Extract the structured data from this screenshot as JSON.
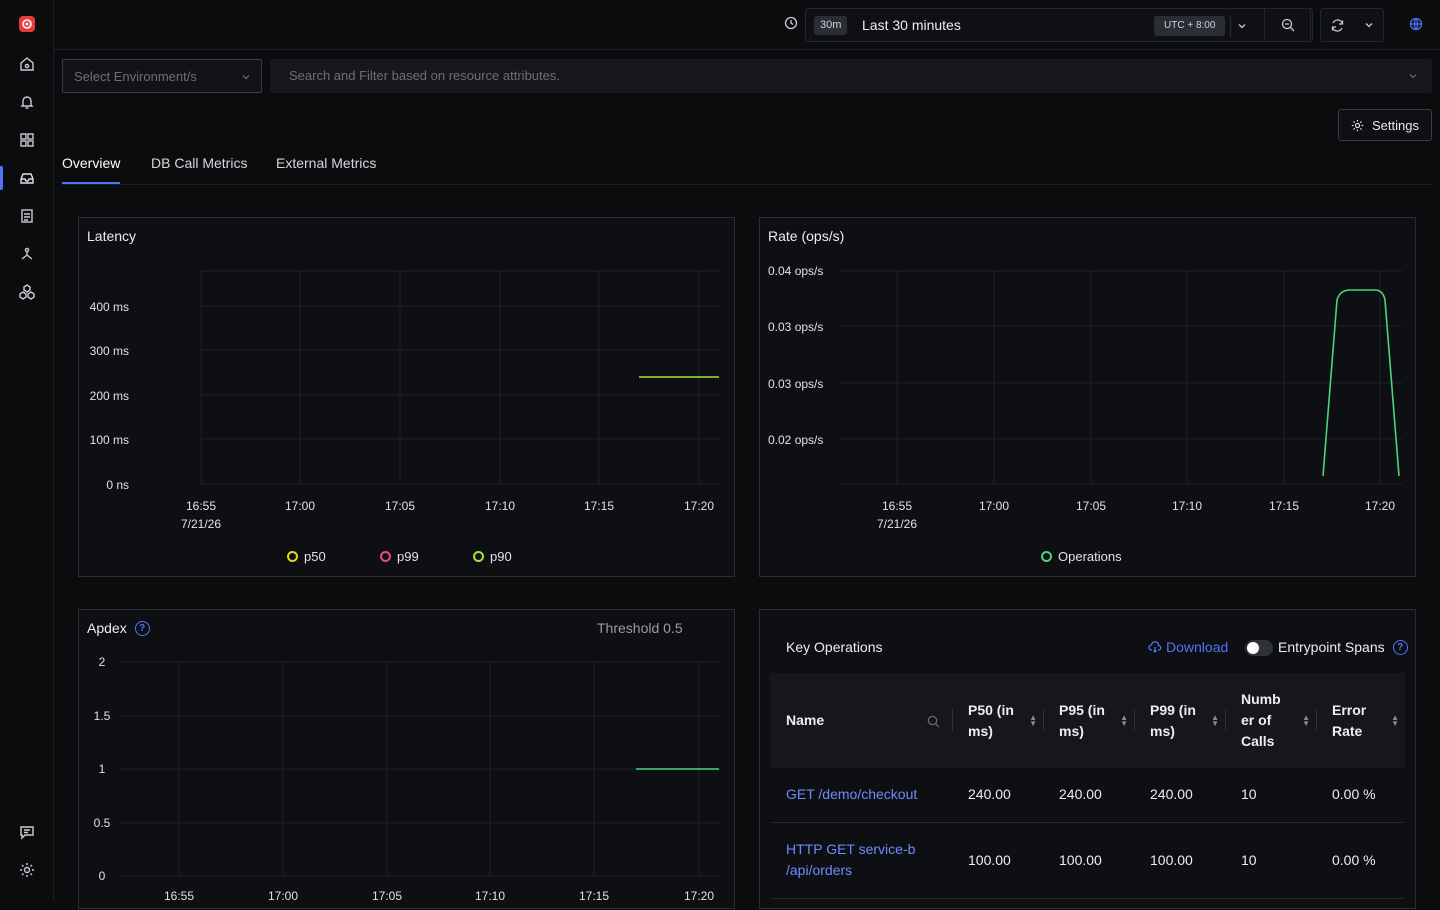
{
  "time_picker": {
    "short": "30m",
    "label": "Last 30 minutes",
    "timezone": "UTC + 8:00"
  },
  "filters": {
    "env_placeholder": "Select Environment/s",
    "search_placeholder": "Search and Filter based on resource attributes."
  },
  "settings_label": "Settings",
  "tabs": [
    {
      "label": "Overview"
    },
    {
      "label": "DB Call Metrics"
    },
    {
      "label": "External Metrics"
    }
  ],
  "latency": {
    "title": "Latency",
    "legend": [
      {
        "name": "p50",
        "color": "#e8d41a"
      },
      {
        "name": "p99",
        "color": "#e8497a"
      },
      {
        "name": "p90",
        "color": "#a6e23a"
      }
    ]
  },
  "rate": {
    "title": "Rate (ops/s)",
    "legend": [
      {
        "name": "Operations",
        "color": "#4cd37a"
      }
    ]
  },
  "apdex": {
    "title": "Apdex",
    "threshold": "Threshold 0.5"
  },
  "key_operations": {
    "title": "Key Operations",
    "download": "Download",
    "entrypoint": "Entrypoint Spans",
    "columns": [
      "Name",
      "P50 (in ms)",
      "P95 (in ms)",
      "P99 (in ms)",
      "Number of Calls",
      "Error Rate"
    ],
    "rows": [
      {
        "name": "GET /demo/checkout",
        "p50": "240.00",
        "p95": "240.00",
        "p99": "240.00",
        "calls": "10",
        "error": "0.00 %"
      },
      {
        "name": "HTTP GET service-b /api/orders",
        "p50": "100.00",
        "p95": "100.00",
        "p99": "100.00",
        "calls": "10",
        "error": "0.00 %"
      }
    ]
  },
  "chart_data": [
    {
      "type": "line",
      "title": "Latency",
      "x_ticks": [
        "16:55\n7/21/26",
        "17:00",
        "17:05",
        "17:10",
        "17:15",
        "17:20"
      ],
      "y_ticks": [
        "0 ns",
        "100 ms",
        "200 ms",
        "300 ms",
        "400 ms"
      ],
      "ylim": [
        0,
        400
      ],
      "series": [
        {
          "name": "p50",
          "color": "#e8d41a",
          "points": []
        },
        {
          "name": "p99",
          "color": "#e8497a",
          "points": []
        },
        {
          "name": "p90",
          "color": "#a6e23a",
          "points": [
            [
              "17:17",
              240
            ],
            [
              "17:21",
              240
            ]
          ]
        }
      ]
    },
    {
      "type": "line",
      "title": "Rate (ops/s)",
      "x_ticks": [
        "16:55\n7/21/26",
        "17:00",
        "17:05",
        "17:10",
        "17:15",
        "17:20"
      ],
      "y_ticks": [
        "0.02 ops/s",
        "0.03 ops/s",
        "0.03 ops/s",
        "0.04 ops/s"
      ],
      "series": [
        {
          "name": "Operations",
          "color": "#4cd37a",
          "points": [
            [
              "17:17",
              0.015
            ],
            [
              "17:18",
              0.037
            ],
            [
              "17:19",
              0.037
            ],
            [
              "17:20",
              0.015
            ]
          ]
        }
      ]
    },
    {
      "type": "line",
      "title": "Apdex",
      "x_ticks": [
        "16:55",
        "17:00",
        "17:05",
        "17:10",
        "17:15",
        "17:20"
      ],
      "y_ticks": [
        "0",
        "0.5",
        "1",
        "1.5",
        "2"
      ],
      "ylim": [
        0,
        2
      ],
      "series": [
        {
          "name": "Apdex",
          "color": "#4cd37a",
          "points": [
            [
              "17:17",
              1
            ],
            [
              "17:21",
              1
            ]
          ]
        }
      ]
    }
  ]
}
